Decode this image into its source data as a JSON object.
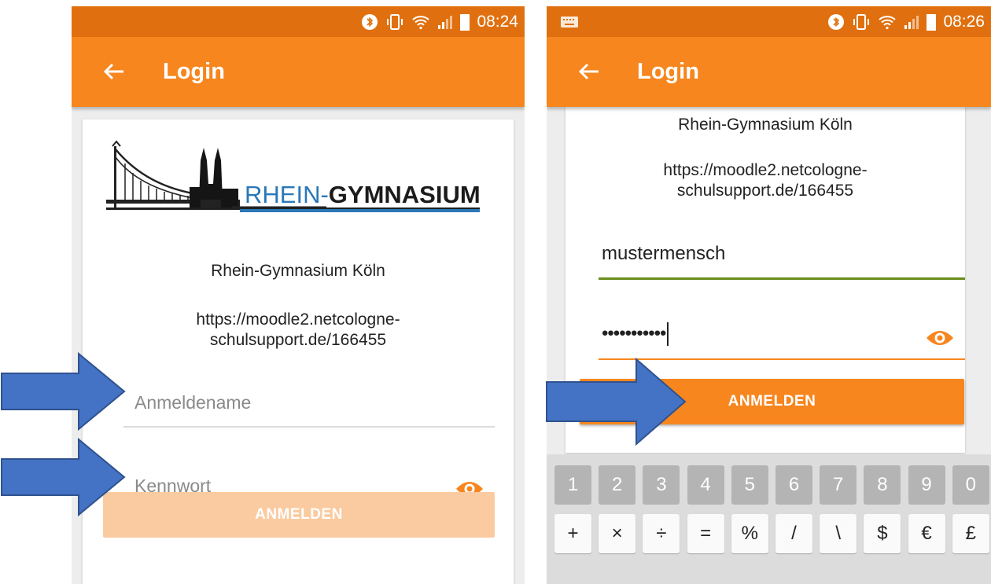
{
  "left": {
    "status": {
      "time": "08:24"
    },
    "appbar": {
      "title": "Login"
    },
    "school_name": "Rhein-Gymnasium Köln",
    "url_line1": "https://moodle2.netcologne-",
    "url_line2": "schulsupport.de/166455",
    "logo": {
      "prefix": "RHEIN-",
      "suffix": "GYMNASIUM"
    },
    "username": {
      "placeholder": "Anmeldename"
    },
    "password": {
      "placeholder": "Kennwort"
    },
    "login_button": "ANMELDEN"
  },
  "right": {
    "status": {
      "time": "08:26"
    },
    "appbar": {
      "title": "Login"
    },
    "school_name": "Rhein-Gymnasium Köln",
    "url_line1": "https://moodle2.netcologne-",
    "url_line2": "schulsupport.de/166455",
    "username": {
      "value": "mustermensch"
    },
    "password": {
      "value": "•••••••••••"
    },
    "login_button": "ANMELDEN"
  },
  "keyboard": {
    "numbers": [
      "1",
      "2",
      "3",
      "4",
      "5",
      "6",
      "7",
      "8",
      "9",
      "0"
    ],
    "symbols": [
      "+",
      "×",
      "÷",
      "=",
      "%",
      "/",
      "\\",
      "$",
      "€",
      "£"
    ]
  },
  "colors": {
    "status_bar": "#e0700f",
    "app_bar": "#f7861e",
    "button_disabled": "#facba1",
    "button_active": "#f7861e",
    "focus_underline": "#6a8c1a",
    "arrow": "#4472c4"
  }
}
